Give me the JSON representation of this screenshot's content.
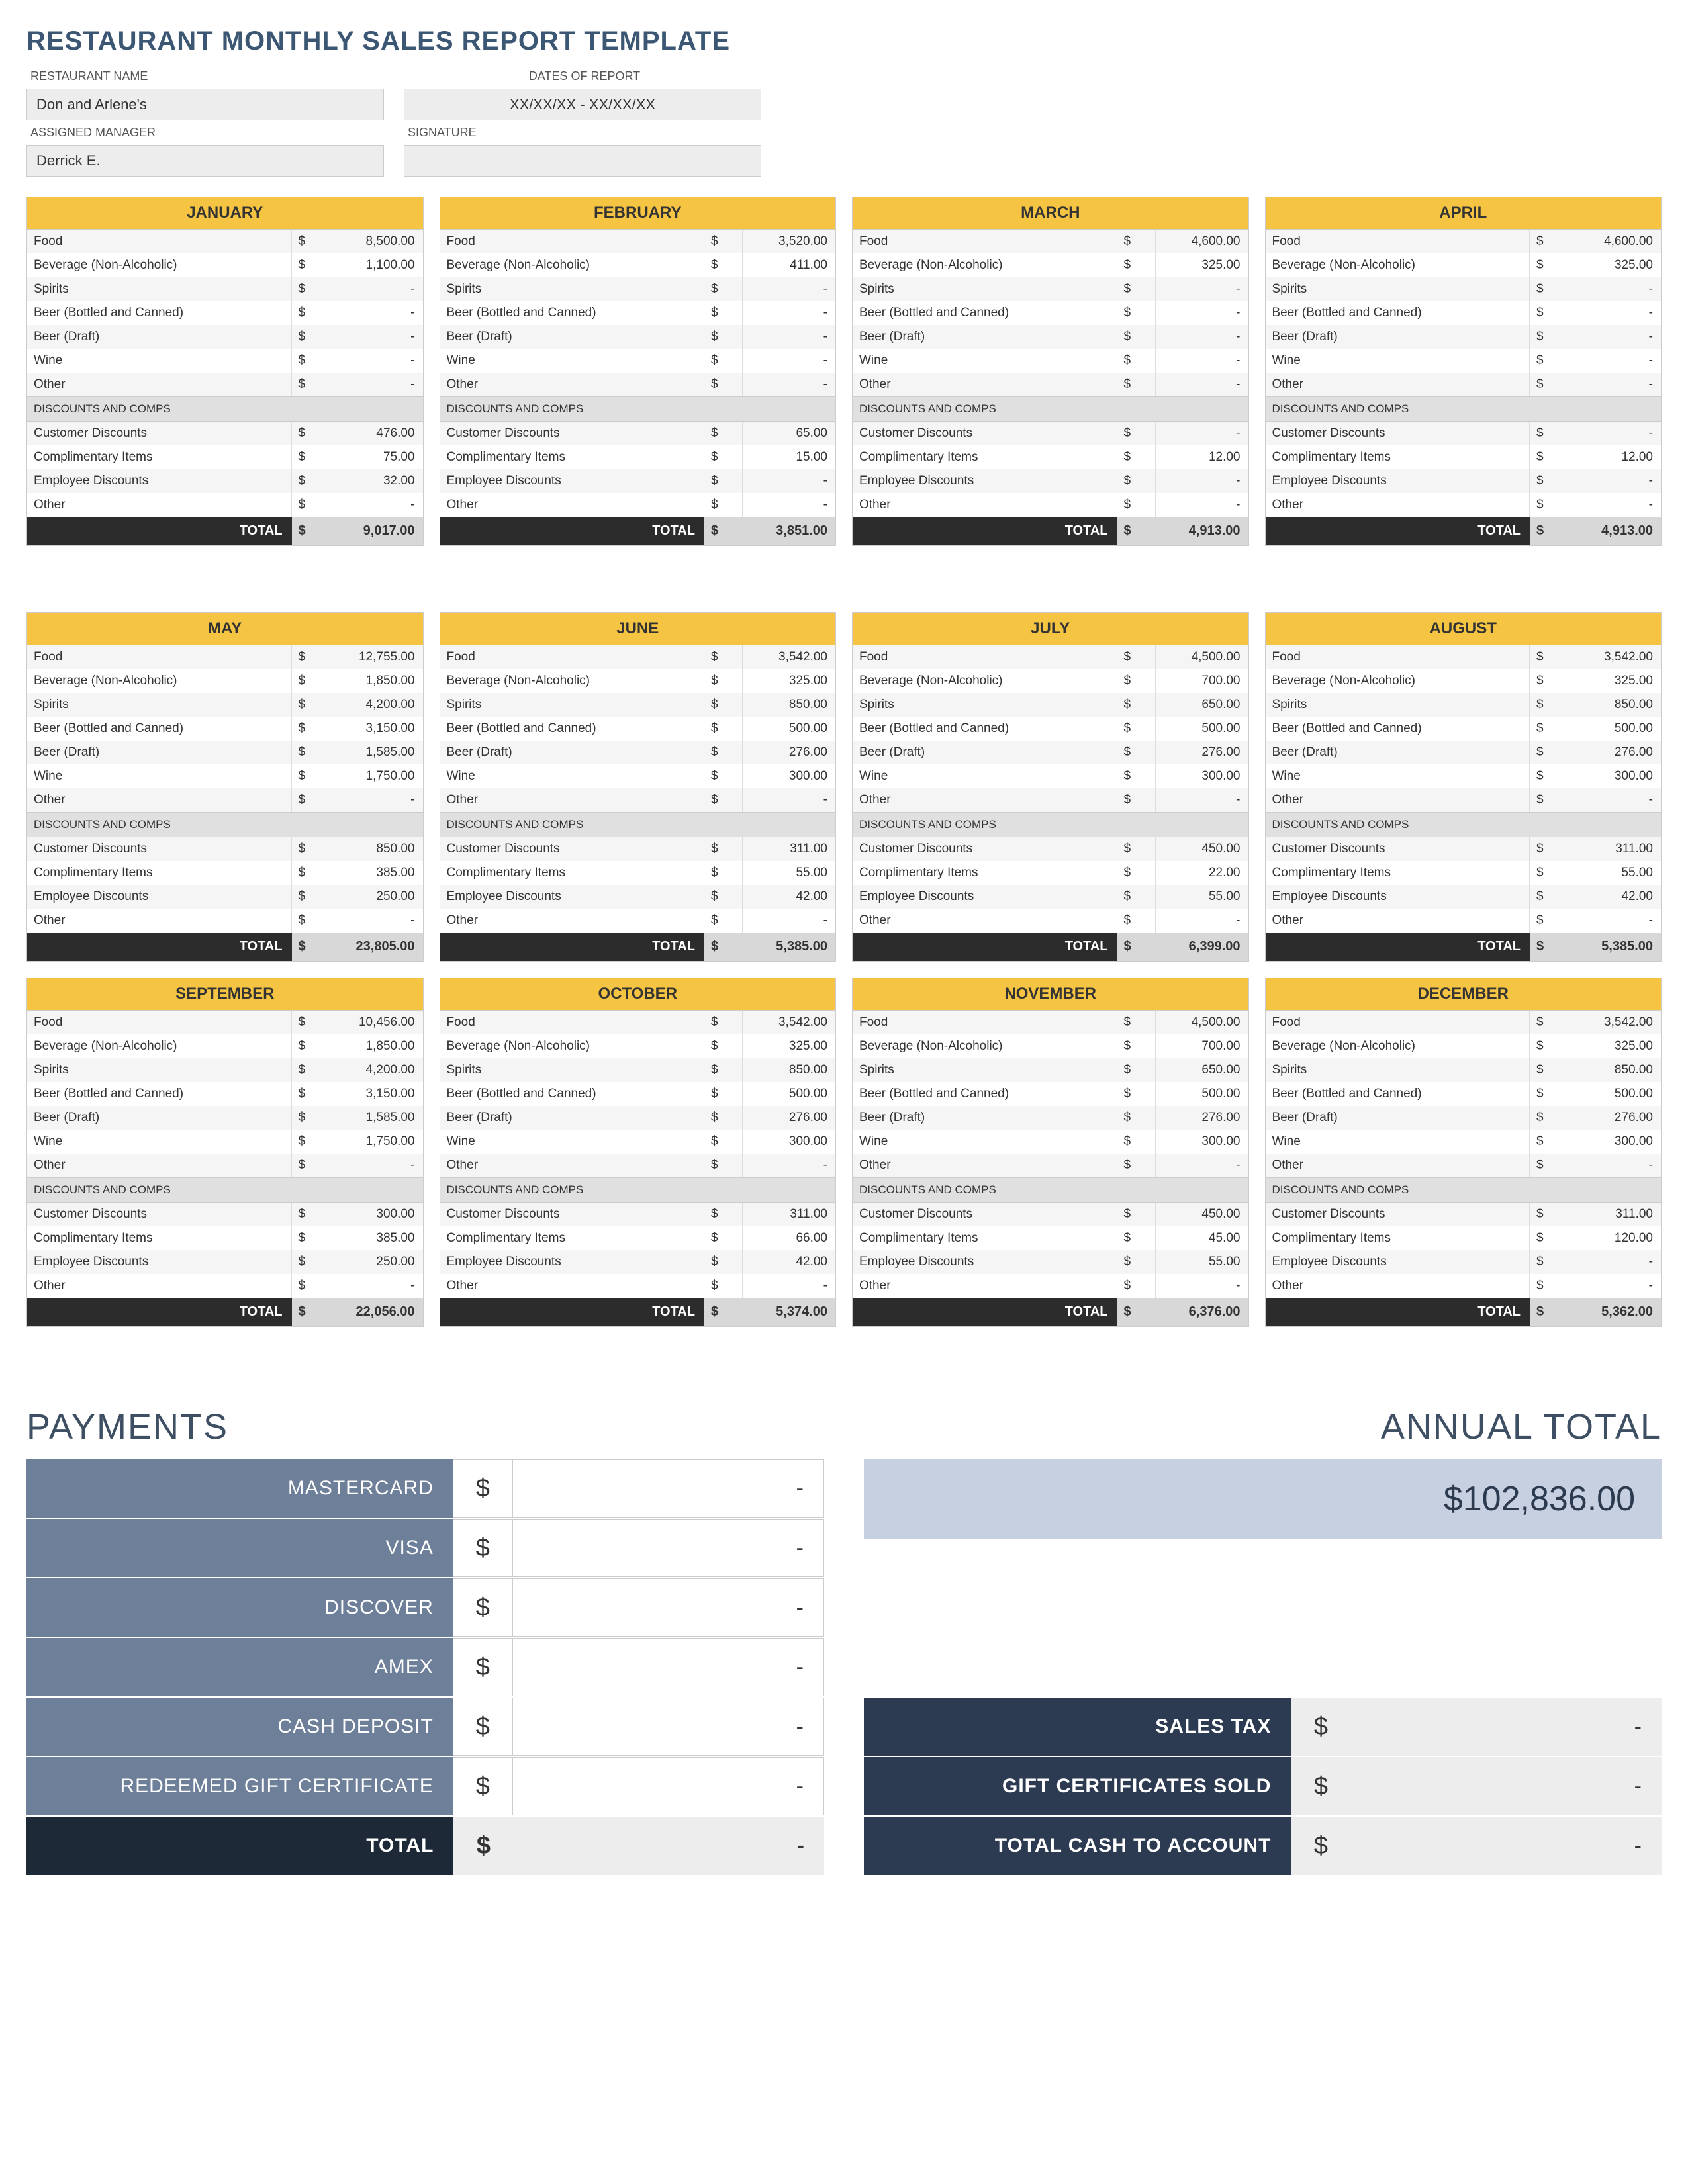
{
  "title": "RESTAURANT MONTHLY SALES REPORT TEMPLATE",
  "info": {
    "restaurant_label": "RESTAURANT NAME",
    "restaurant_value": "Don and Arlene's",
    "manager_label": "ASSIGNED MANAGER",
    "manager_value": "Derrick E.",
    "dates_label": "DATES OF REPORT",
    "dates_value": "XX/XX/XX - XX/XX/XX",
    "signature_label": "SIGNATURE",
    "signature_value": ""
  },
  "row_labels": {
    "food": "Food",
    "bev": "Beverage (Non-Alcoholic)",
    "spirits": "Spirits",
    "beer_bc": "Beer (Bottled and Canned)",
    "beer_d": "Beer (Draft)",
    "wine": "Wine",
    "other": "Other",
    "disc_section": "DISCOUNTS AND COMPS",
    "cust_disc": "Customer Discounts",
    "comp_items": "Complimentary Items",
    "emp_disc": "Employee Discounts",
    "other2": "Other",
    "total": "TOTAL",
    "currency": "$",
    "dash": "-"
  },
  "months": [
    {
      "name": "JANUARY",
      "food": "8,500.00",
      "bev": "1,100.00",
      "spirits": "-",
      "beer_bc": "-",
      "beer_d": "-",
      "wine": "-",
      "other": "-",
      "cust_disc": "476.00",
      "comp_items": "75.00",
      "emp_disc": "32.00",
      "other2": "-",
      "total": "9,017.00"
    },
    {
      "name": "FEBRUARY",
      "food": "3,520.00",
      "bev": "411.00",
      "spirits": "-",
      "beer_bc": "-",
      "beer_d": "-",
      "wine": "-",
      "other": "-",
      "cust_disc": "65.00",
      "comp_items": "15.00",
      "emp_disc": "-",
      "other2": "-",
      "total": "3,851.00"
    },
    {
      "name": "MARCH",
      "food": "4,600.00",
      "bev": "325.00",
      "spirits": "-",
      "beer_bc": "-",
      "beer_d": "-",
      "wine": "-",
      "other": "-",
      "cust_disc": "-",
      "comp_items": "12.00",
      "emp_disc": "-",
      "other2": "-",
      "total": "4,913.00"
    },
    {
      "name": "APRIL",
      "food": "4,600.00",
      "bev": "325.00",
      "spirits": "-",
      "beer_bc": "-",
      "beer_d": "-",
      "wine": "-",
      "other": "-",
      "cust_disc": "-",
      "comp_items": "12.00",
      "emp_disc": "-",
      "other2": "-",
      "total": "4,913.00"
    },
    {
      "name": "MAY",
      "food": "12,755.00",
      "bev": "1,850.00",
      "spirits": "4,200.00",
      "beer_bc": "3,150.00",
      "beer_d": "1,585.00",
      "wine": "1,750.00",
      "other": "-",
      "cust_disc": "850.00",
      "comp_items": "385.00",
      "emp_disc": "250.00",
      "other2": "-",
      "total": "23,805.00"
    },
    {
      "name": "JUNE",
      "food": "3,542.00",
      "bev": "325.00",
      "spirits": "850.00",
      "beer_bc": "500.00",
      "beer_d": "276.00",
      "wine": "300.00",
      "other": "-",
      "cust_disc": "311.00",
      "comp_items": "55.00",
      "emp_disc": "42.00",
      "other2": "-",
      "total": "5,385.00"
    },
    {
      "name": "JULY",
      "food": "4,500.00",
      "bev": "700.00",
      "spirits": "650.00",
      "beer_bc": "500.00",
      "beer_d": "276.00",
      "wine": "300.00",
      "other": "-",
      "cust_disc": "450.00",
      "comp_items": "22.00",
      "emp_disc": "55.00",
      "other2": "-",
      "total": "6,399.00"
    },
    {
      "name": "AUGUST",
      "food": "3,542.00",
      "bev": "325.00",
      "spirits": "850.00",
      "beer_bc": "500.00",
      "beer_d": "276.00",
      "wine": "300.00",
      "other": "-",
      "cust_disc": "311.00",
      "comp_items": "55.00",
      "emp_disc": "42.00",
      "other2": "-",
      "total": "5,385.00"
    },
    {
      "name": "SEPTEMBER",
      "food": "10,456.00",
      "bev": "1,850.00",
      "spirits": "4,200.00",
      "beer_bc": "3,150.00",
      "beer_d": "1,585.00",
      "wine": "1,750.00",
      "other": "-",
      "cust_disc": "300.00",
      "comp_items": "385.00",
      "emp_disc": "250.00",
      "other2": "-",
      "total": "22,056.00"
    },
    {
      "name": "OCTOBER",
      "food": "3,542.00",
      "bev": "325.00",
      "spirits": "850.00",
      "beer_bc": "500.00",
      "beer_d": "276.00",
      "wine": "300.00",
      "other": "-",
      "cust_disc": "311.00",
      "comp_items": "66.00",
      "emp_disc": "42.00",
      "other2": "-",
      "total": "5,374.00"
    },
    {
      "name": "NOVEMBER",
      "food": "4,500.00",
      "bev": "700.00",
      "spirits": "650.00",
      "beer_bc": "500.00",
      "beer_d": "276.00",
      "wine": "300.00",
      "other": "-",
      "cust_disc": "450.00",
      "comp_items": "45.00",
      "emp_disc": "55.00",
      "other2": "-",
      "total": "6,376.00"
    },
    {
      "name": "DECEMBER",
      "food": "3,542.00",
      "bev": "325.00",
      "spirits": "850.00",
      "beer_bc": "500.00",
      "beer_d": "276.00",
      "wine": "300.00",
      "other": "-",
      "cust_disc": "311.00",
      "comp_items": "120.00",
      "emp_disc": "-",
      "other2": "-",
      "total": "5,362.00"
    }
  ],
  "payments": {
    "heading": "PAYMENTS",
    "items": [
      {
        "label": "MASTERCARD",
        "value": "-"
      },
      {
        "label": "VISA",
        "value": "-"
      },
      {
        "label": "DISCOVER",
        "value": "-"
      },
      {
        "label": "AMEX",
        "value": "-"
      },
      {
        "label": "CASH DEPOSIT",
        "value": "-"
      },
      {
        "label": "REDEEMED GIFT CERTIFICATE",
        "value": "-"
      }
    ],
    "total_label": "TOTAL",
    "total_value": "-"
  },
  "annual": {
    "heading": "ANNUAL TOTAL",
    "value": "$102,836.00",
    "summary": [
      {
        "label": "SALES TAX",
        "value": "-"
      },
      {
        "label": "GIFT CERTIFICATES SOLD",
        "value": "-"
      },
      {
        "label": "TOTAL CASH TO ACCOUNT",
        "value": "-"
      }
    ]
  }
}
